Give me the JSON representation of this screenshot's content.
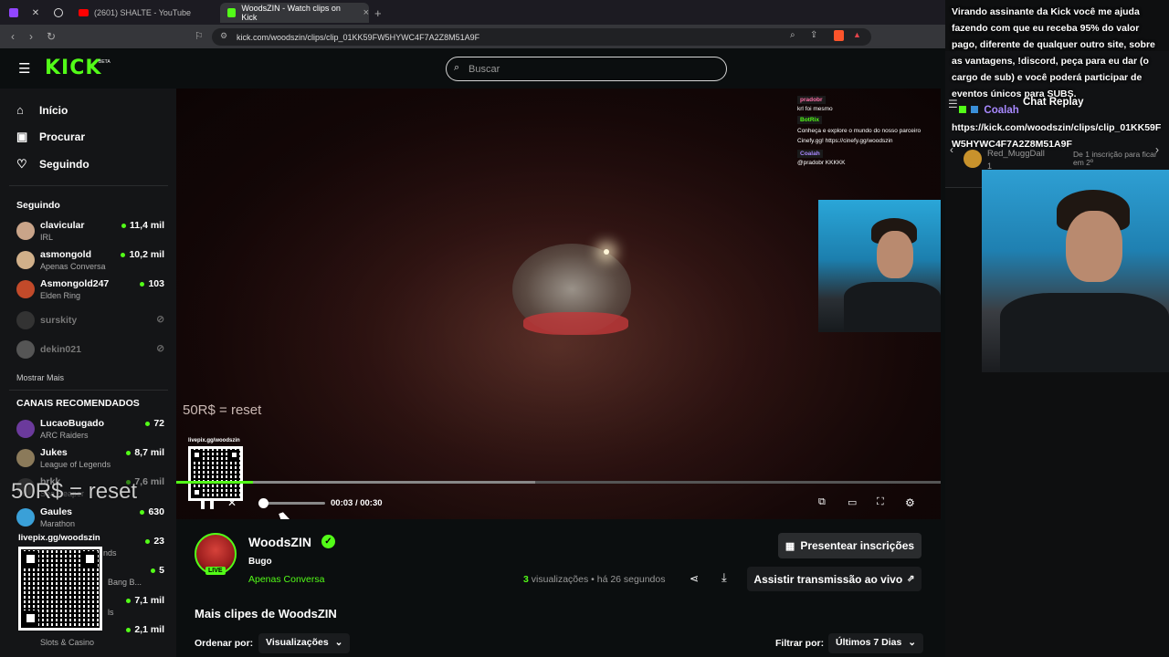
{
  "browser": {
    "tabs": [
      {
        "label": ""
      },
      {
        "label": ""
      },
      {
        "label": ""
      },
      {
        "label": "(2601) SHALTE - YouTube"
      },
      {
        "label": "WoodsZIN - Watch clips on Kick"
      }
    ],
    "url": "kick.com/woodszin/clips/clip_01KK59FW5HYWC4F7A2Z8M51A9F"
  },
  "header": {
    "logo": "KICK",
    "logo_badge": "BETA",
    "search_placeholder": "Buscar"
  },
  "sidebar": {
    "nav": [
      {
        "label": "Início",
        "icon": "home-icon"
      },
      {
        "label": "Procurar",
        "icon": "browse-icon"
      },
      {
        "label": "Seguindo",
        "icon": "heart-icon"
      }
    ],
    "following_title": "Seguindo",
    "following": [
      {
        "name": "clavicular",
        "category": "IRL",
        "viewers": "11,4 mil",
        "avatar_color": "#c9a489"
      },
      {
        "name": "asmongold",
        "category": "Apenas Conversa",
        "viewers": "10,2 mil",
        "avatar_color": "#d1b08a"
      },
      {
        "name": "Asmongold247",
        "category": "Elden Ring",
        "viewers": "103",
        "avatar_color": "#c24a2a"
      }
    ],
    "following_offline": [
      {
        "name": "surskity",
        "avatar_color": "#333333"
      },
      {
        "name": "dekin021",
        "avatar_color": "#555555"
      }
    ],
    "show_more": "Mostrar Mais",
    "recommended_title": "CANAIS RECOMENDADOS",
    "recommended": [
      {
        "name": "LucaoBugado",
        "category": "ARC Raiders",
        "viewers": "72",
        "avatar_color": "#6b3a9c"
      },
      {
        "name": "Jukes",
        "category": "League of Legends",
        "viewers": "8,7 mil",
        "avatar_color": "#8b7a5a"
      },
      {
        "name": "brkk",
        "category": "Sea Reaper",
        "viewers": "7,6 mil",
        "avatar_color": "#4a4a4a"
      },
      {
        "name": "Gaules",
        "category": "Marathon",
        "viewers": "630",
        "avatar_color": "#3aa0d8"
      },
      {
        "name": "",
        "category": "nds",
        "viewers": "23",
        "avatar_color": "#333333"
      },
      {
        "name": "",
        "category": "Bang B...",
        "viewers": "5",
        "avatar_color": "#333333"
      },
      {
        "name": "",
        "category": "ls",
        "viewers": "7,1 mil",
        "avatar_color": "#333333"
      },
      {
        "name": "",
        "category": "Slots & Casino",
        "viewers": "2,1 mil",
        "avatar_color": "#333333"
      }
    ]
  },
  "video": {
    "caption": "50R$ = reset",
    "qr_label": "livepix.gg/woodszin",
    "time_current": "00:03",
    "time_total": "00:30",
    "progress": 0.1,
    "buffered": 0.47,
    "chat_overlay": [
      {
        "user": "pradobr",
        "text": "krl foi mesmo",
        "color": "#ff6fa8"
      },
      {
        "user": "BotRix",
        "text": "Conheça e explore o mundo do nosso parceiro Cinefy.gg! https://cinefy.gg/woodszin",
        "color": "#53fc18"
      },
      {
        "user": "Coalah",
        "text": "@pradobr KKKKK",
        "color": "#a889ff"
      }
    ]
  },
  "channel": {
    "name": "WoodsZIN",
    "clip_title": "Bugo",
    "category": "Apenas Conversa",
    "live_badge": "LIVE",
    "views_count": "3",
    "views_label": "visualizações",
    "time_ago": "há 26 segundos",
    "gift_button": "Presentear inscrições",
    "watch_button": "Assistir transmissão ao vivo",
    "more_clips": "Mais clipes de WoodsZIN",
    "sort_label": "Ordenar por:",
    "sort_value": "Visualizações",
    "filter_label": "Filtrar por:",
    "filter_value": "Últimos 7 Dias"
  },
  "right_panel": {
    "message": "Virando assinante da Kick você me ajuda fazendo com que eu receba 95% do valor pago, diferente de qualquer outro site, sobre as vantagens, !discord, peça para eu dar (o cargo de sub) e você poderá participar de eventos únicos para SUBS.",
    "chat_replay": "Chat Replay",
    "chat_user": "Coalah",
    "link": "https://kick.com/woodszin/clips/clip_01KK59FW5HYWC4F7A2Z8M51A9F",
    "gifter": "Red_MuggDall",
    "gifter_count": "1",
    "gift_text": "De 1 inscrição para ficar em 2º"
  },
  "overlay": {
    "caption": "50R$ = reset",
    "qr_label": "livepix.gg/woodszin"
  },
  "colors": {
    "accent": "#53fc18",
    "background": "#0b0e0f",
    "sidebar": "#141517"
  }
}
